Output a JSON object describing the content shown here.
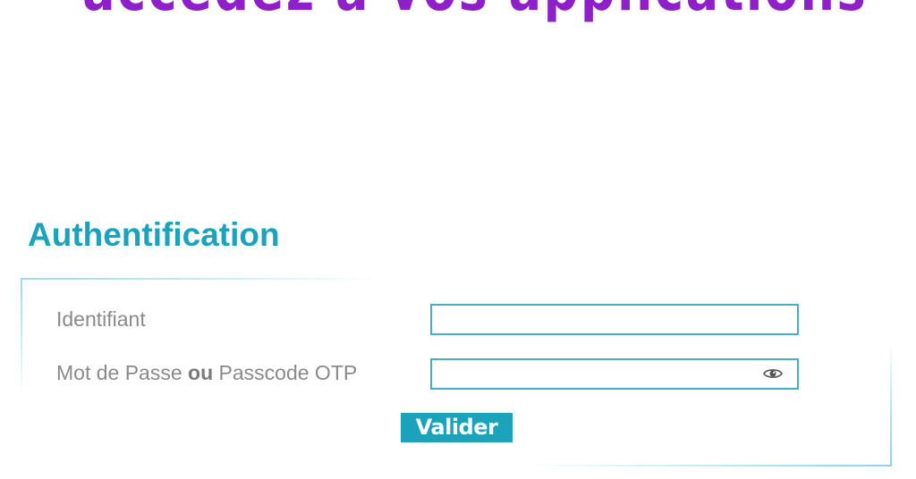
{
  "banner": {
    "title": "accedez a vos applications"
  },
  "auth": {
    "section_title": "Authentification",
    "identifiant_label": "Identifiant",
    "identifiant_value": "",
    "password_label_part1": "Mot de Passe ",
    "password_label_or": "ou",
    "password_label_part2": " Passcode OTP",
    "password_value": "",
    "show_password_icon": "eye-icon",
    "submit_label": "Valider"
  },
  "colors": {
    "banner_purple": "#8e1fc9",
    "accent_teal": "#1ba3bb",
    "input_border": "#45b0c4",
    "label_gray": "#8a8a8a"
  }
}
